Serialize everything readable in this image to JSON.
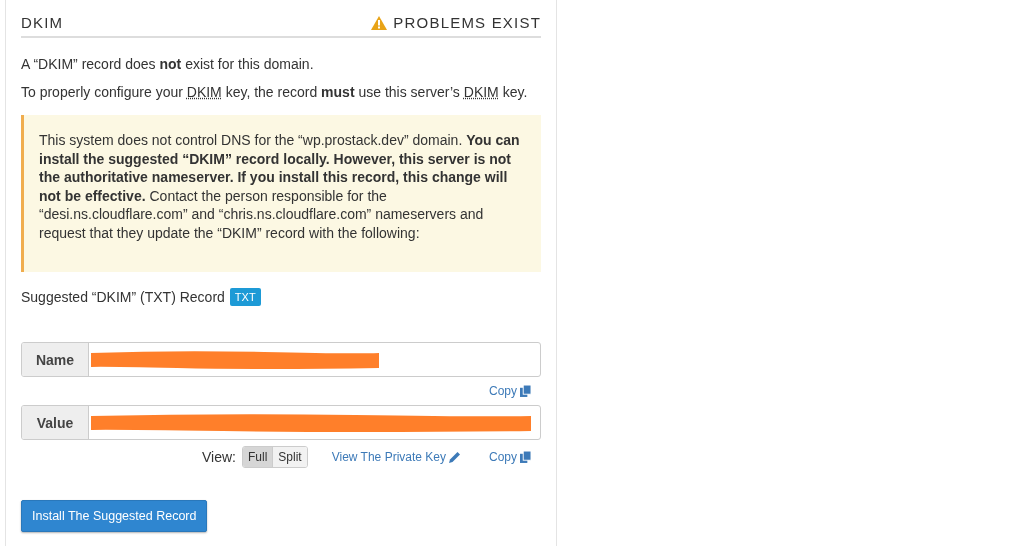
{
  "section": {
    "title": "DKIM",
    "status": {
      "kind": "warning",
      "label": "PROBLEMS EXIST"
    }
  },
  "paragraphs": [
    [
      {
        "kind": "text",
        "text": "A “DKIM” record does "
      },
      {
        "kind": "bold",
        "text": "not"
      },
      {
        "kind": "text",
        "text": " exist for this domain."
      }
    ],
    [
      {
        "kind": "text",
        "text": "To properly configure your "
      },
      {
        "kind": "abbr",
        "text": "DKIM"
      },
      {
        "kind": "text",
        "text": " key, the record "
      },
      {
        "kind": "bold",
        "text": "must"
      },
      {
        "kind": "text",
        "text": " use this server’s "
      },
      {
        "kind": "abbr",
        "text": "DKIM"
      },
      {
        "kind": "text",
        "text": " key."
      }
    ]
  ],
  "alert": {
    "text": "This system does not control DNS for the “wp.prostack.dev” domain. **You can install the suggested “DKIM” record locally. However, this server is not the authoritative nameserver. If you install this record, this change will not be effective.** Contact the person responsible for the “desi.ns.cloudflare.com” and “chris.ns.cloudflare.com” nameservers and request that they update the “DKIM” record with the following:"
  },
  "record": {
    "label": "Suggested “DKIM” (TXT) Record",
    "badge": "TXT"
  },
  "fields": [
    {
      "label": "Name",
      "redacted": true,
      "copy": "Copy"
    },
    {
      "label": "Value",
      "redacted": true,
      "copy": "Copy"
    }
  ],
  "view": {
    "label": "View:",
    "options": [
      {
        "label": "Full",
        "selected": true
      },
      {
        "label": "Split",
        "selected": false
      }
    ],
    "private_key_link": "View The Private Key"
  },
  "install_button": "Install The Suggested Record"
}
